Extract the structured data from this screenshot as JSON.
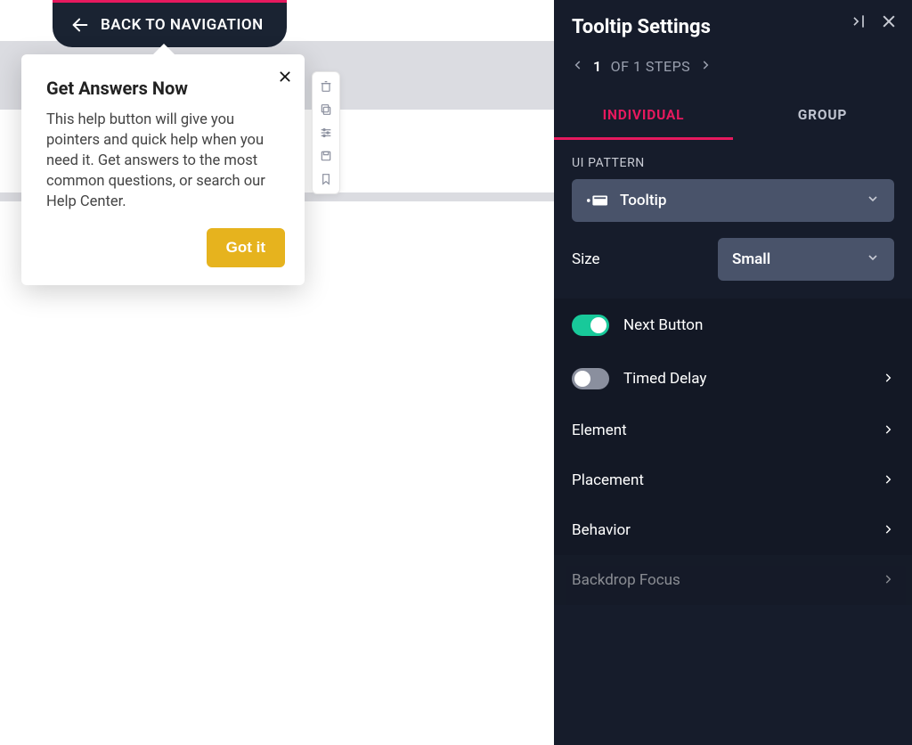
{
  "nav": {
    "back_label": "BACK TO NAVIGATION"
  },
  "tooltip": {
    "title": "Get Answers Now",
    "body": "This help button will give you pointers and quick help when you need it. Get answers to the most common questions, or search our Help Center.",
    "cta": "Got it"
  },
  "panel": {
    "title": "Tooltip Settings",
    "steps": {
      "current": "1",
      "suffix": "OF 1 STEPS"
    },
    "tabs": {
      "individual": "INDIVIDUAL",
      "group": "GROUP"
    },
    "ui_pattern_label": "UI PATTERN",
    "ui_pattern_value": "Tooltip",
    "size_label": "Size",
    "size_value": "Small",
    "settings": {
      "next_button": "Next Button",
      "timed_delay": "Timed Delay",
      "element": "Element",
      "placement": "Placement",
      "behavior": "Behavior",
      "backdrop": "Backdrop Focus"
    }
  }
}
